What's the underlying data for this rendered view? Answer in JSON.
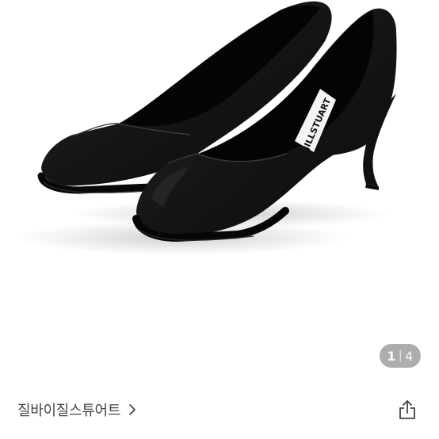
{
  "gallery": {
    "image_alt": "black square-toe heel pumps",
    "insole_brand_text": "JILLSTUART",
    "counter": {
      "current": "1",
      "separator": "|",
      "total": "4"
    }
  },
  "store": {
    "name": "질바이질스튜어트",
    "chevron_icon": "chevron-right-icon"
  },
  "actions": {
    "share_icon": "share-icon"
  },
  "colors": {
    "shoe": "#141414",
    "counter_bg": "#969696",
    "text": "#444444"
  }
}
